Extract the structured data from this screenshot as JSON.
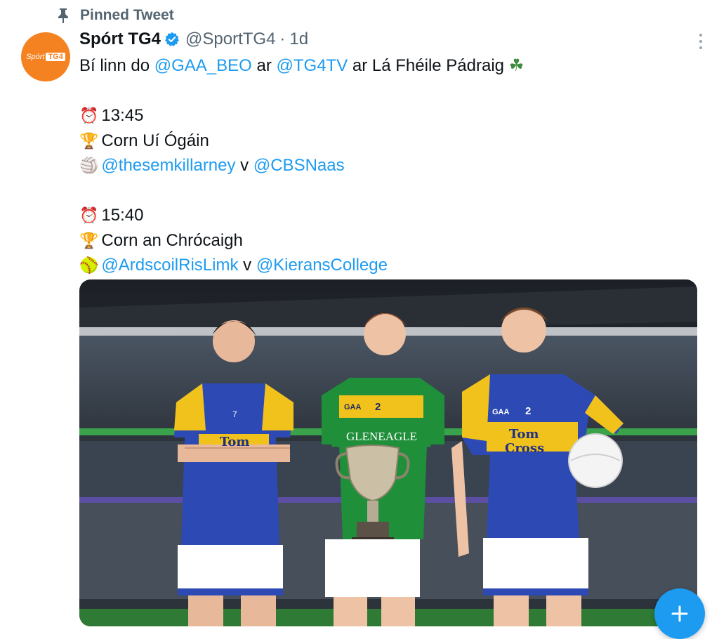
{
  "pinned": {
    "label": "Pinned Tweet"
  },
  "author": {
    "name": "Spórt TG4",
    "handle": "@SportTG4",
    "separator": "·",
    "time": "1d",
    "avatar_text": "Spórt",
    "avatar_badge": "TG4"
  },
  "tweet": {
    "l1_before": "Bí linn do ",
    "l1_m1": "@GAA_BEO",
    "l1_mid": " ar ",
    "l1_m2": "@TG4TV",
    "l1_after": " ar Lá Fhéile Pádraig ",
    "l1_emoji": "☘",
    "match1_time": "13:45",
    "match1_cup": "Corn Uí Ógáin",
    "match1_team1": "@thesemkillarney",
    "match1_v": " v ",
    "match1_team2": "@CBSNaas",
    "match2_time": "15:40",
    "match2_cup": "Corn an Chrócaigh",
    "match2_team1": "@ArdscoilRisLimk",
    "match2_v": " v ",
    "match2_team2": "@KieransCollege"
  },
  "icons": {
    "clock": "⏰",
    "trophy": "🏆",
    "volleyball": "🏐",
    "softball": "🥎"
  },
  "photo": {
    "jersey_left_brand": "Tom",
    "jersey_center_brand": "GLENEAGLE",
    "jersey_right_brand_1": "Tom",
    "jersey_right_brand_2": "Cross",
    "num_left": "7",
    "num_center": "2",
    "num_right": "2",
    "gaa": "GAA"
  },
  "colors": {
    "accent": "#1d9bf0",
    "brand_orange": "#f58220",
    "muted": "#536471",
    "kit_blue": "#2d49b4",
    "kit_yellow": "#f2c21c",
    "kit_green": "#1f8f3a"
  },
  "fab": {
    "label": "+"
  }
}
